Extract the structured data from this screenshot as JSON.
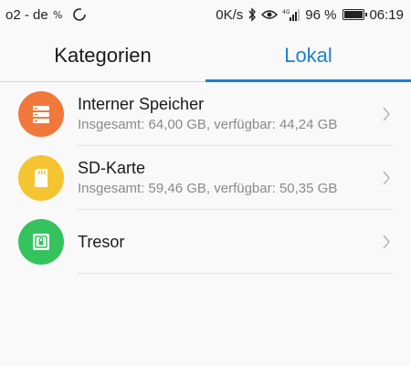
{
  "status_bar": {
    "carrier": "o2 - de",
    "speed": "0K/s",
    "network": "4G",
    "battery": "96 %",
    "battery_level": 0.96,
    "time": "06:19"
  },
  "tabs": [
    {
      "label": "Kategorien",
      "active": false
    },
    {
      "label": "Lokal",
      "active": true
    }
  ],
  "storage_items": [
    {
      "title": "Interner Speicher",
      "subtitle": "Insgesamt: 64,00 GB, verfügbar: 44,24 GB",
      "icon": "server-icon",
      "color": "#f0783a"
    },
    {
      "title": "SD-Karte",
      "subtitle": "Insgesamt: 59,46 GB, verfügbar: 50,35 GB",
      "icon": "sd-card-icon",
      "color": "#f5c531"
    },
    {
      "title": "Tresor",
      "subtitle": "",
      "icon": "safe-icon",
      "color": "#35c35d"
    }
  ],
  "colors": {
    "accent": "#1e7fd0"
  }
}
